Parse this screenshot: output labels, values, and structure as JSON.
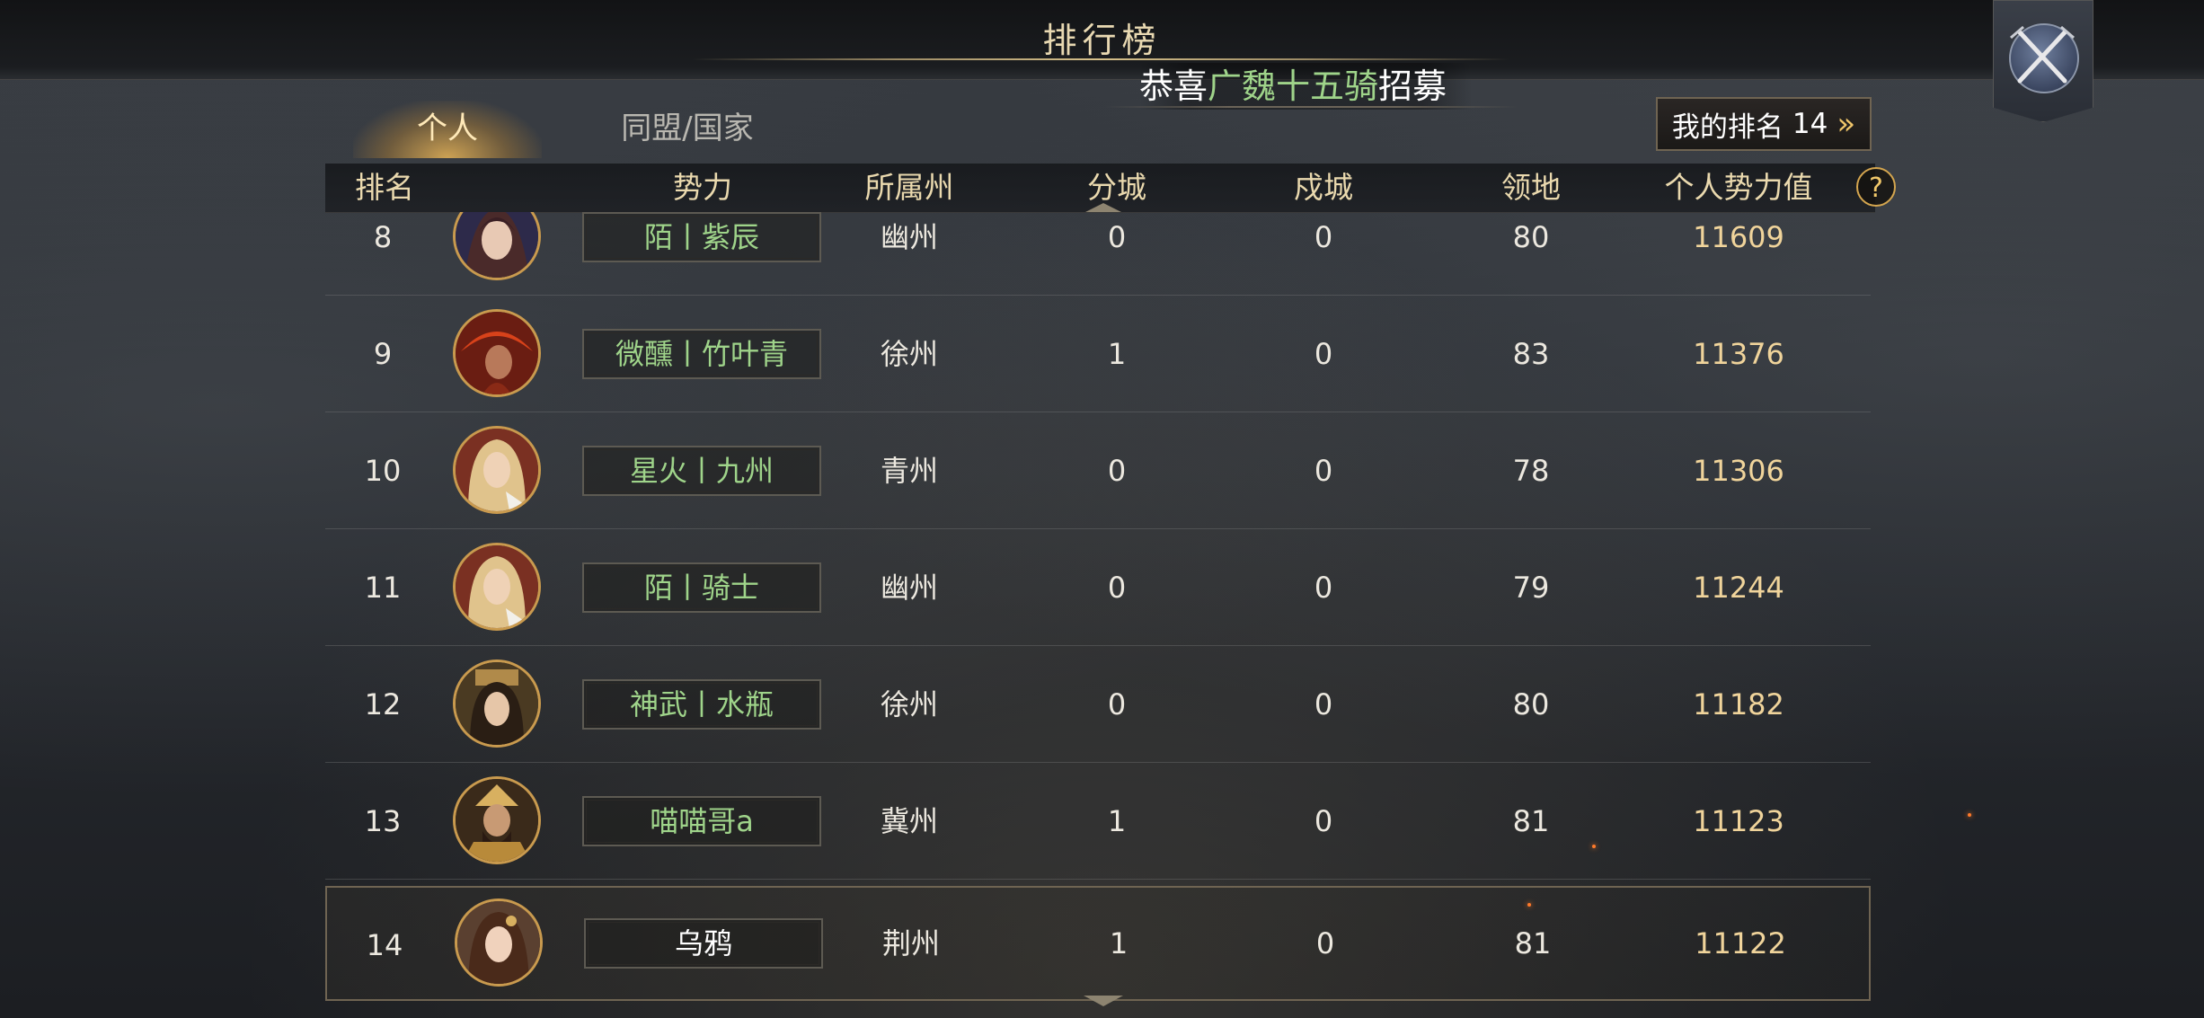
{
  "header": {
    "title": "排行榜",
    "ticker": {
      "prefix": "恭喜",
      "highlight": "广魏十五骑",
      "suffix": "招募"
    }
  },
  "tabs": [
    {
      "label": "个人",
      "active": true
    },
    {
      "label": "同盟/国家",
      "active": false
    }
  ],
  "my_rank": {
    "label": "我的排名",
    "value": "14",
    "chevron": "»"
  },
  "columns": {
    "rank": "排名",
    "faction": "势力",
    "state": "所属州",
    "branch_city": "分城",
    "garrison_city": "戍城",
    "territory": "领地",
    "power": "个人势力值"
  },
  "help_icon": "?",
  "icons": {
    "close": "crossed-swords-icon",
    "help": "question-icon",
    "avatar": "portrait-icon"
  },
  "colors": {
    "faction_name": "#9fd48a",
    "power_value": "#f0d49b",
    "header_text": "#ead9ae",
    "accent_gold": "#d5a64f"
  },
  "rows": [
    {
      "rank": "8",
      "faction": "陌丨紫辰",
      "state": "幽州",
      "branch": "0",
      "garrison": "0",
      "territory": "80",
      "power": "11609",
      "is_me": false
    },
    {
      "rank": "9",
      "faction": "微醺丨竹叶青",
      "state": "徐州",
      "branch": "1",
      "garrison": "0",
      "territory": "83",
      "power": "11376",
      "is_me": false
    },
    {
      "rank": "10",
      "faction": "星火丨九州",
      "state": "青州",
      "branch": "0",
      "garrison": "0",
      "territory": "78",
      "power": "11306",
      "is_me": false
    },
    {
      "rank": "11",
      "faction": "陌丨骑士",
      "state": "幽州",
      "branch": "0",
      "garrison": "0",
      "territory": "79",
      "power": "11244",
      "is_me": false
    },
    {
      "rank": "12",
      "faction": "神武丨水瓶",
      "state": "徐州",
      "branch": "0",
      "garrison": "0",
      "territory": "80",
      "power": "11182",
      "is_me": false
    },
    {
      "rank": "13",
      "faction": "喵喵哥a",
      "state": "冀州",
      "branch": "1",
      "garrison": "0",
      "territory": "81",
      "power": "11123",
      "is_me": false
    },
    {
      "rank": "14",
      "faction": "乌鸦",
      "state": "荆州",
      "branch": "1",
      "garrison": "0",
      "territory": "81",
      "power": "11122",
      "is_me": true
    }
  ]
}
